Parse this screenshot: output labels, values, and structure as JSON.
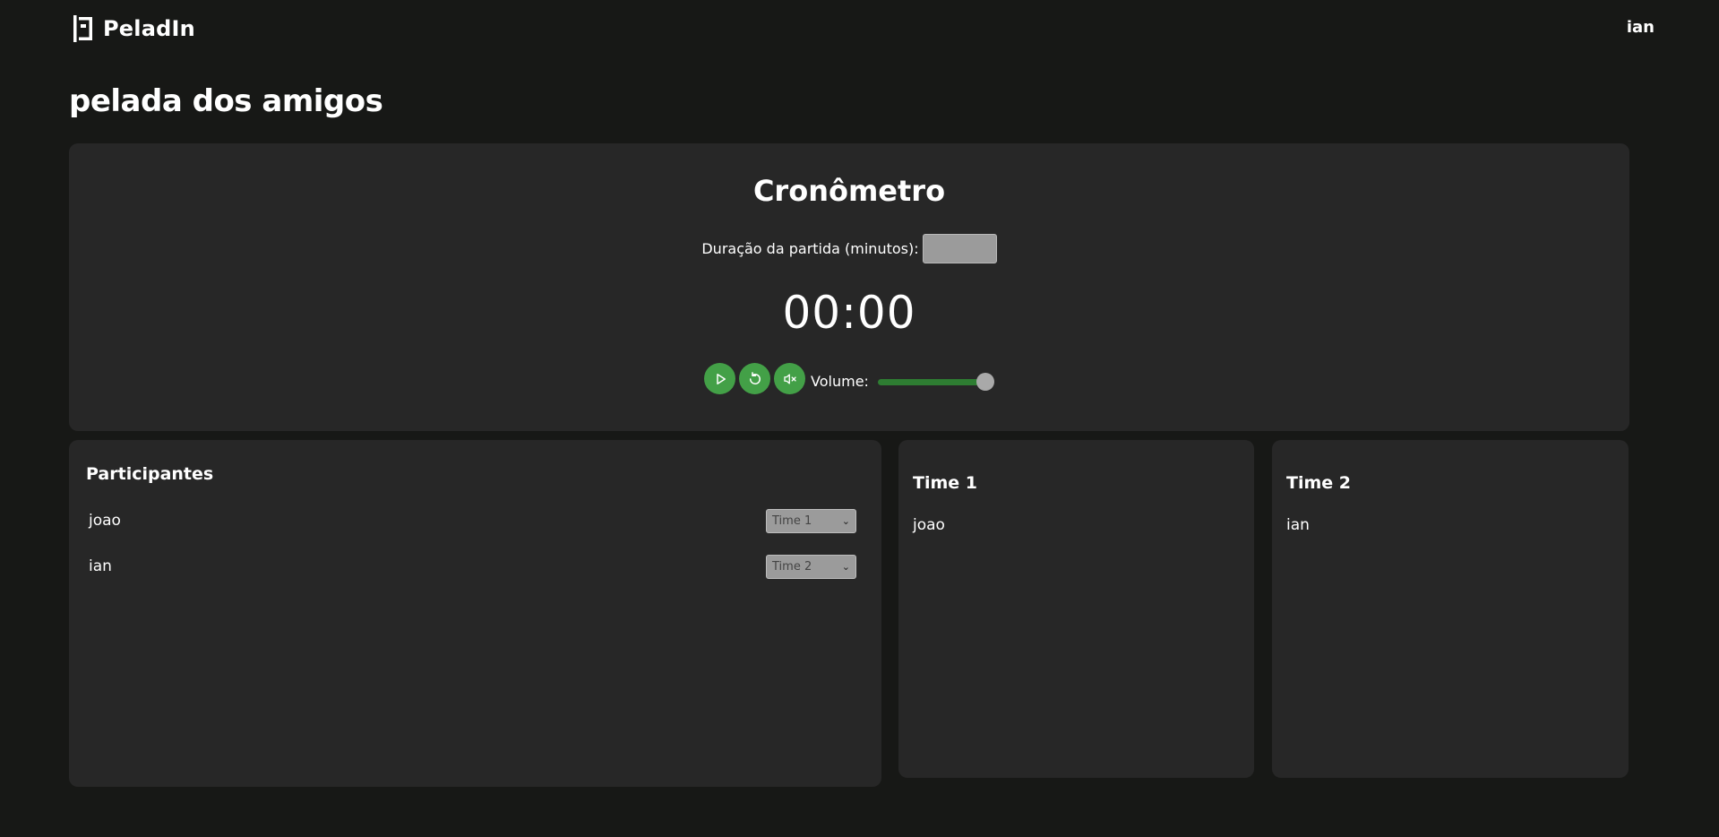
{
  "header": {
    "brand": "PeladIn",
    "user": "ian"
  },
  "page": {
    "title": "pelada dos amigos"
  },
  "timer": {
    "title": "Cronômetro",
    "duration_label": "Duração da partida (minutos):",
    "duration_value": "",
    "display": "00:00",
    "volume_label": "Volume:",
    "volume_level": 1.0
  },
  "participants": {
    "heading": "Participantes",
    "rows": [
      {
        "name": "joao",
        "team": "Time 1"
      },
      {
        "name": "ian",
        "team": "Time 2"
      }
    ]
  },
  "teams": [
    {
      "heading": "Time 1",
      "members": [
        "joao"
      ]
    },
    {
      "heading": "Time 2",
      "members": [
        "ian"
      ]
    }
  ],
  "colors": {
    "background": "#171816",
    "card": "#272727",
    "accent": "#43a047",
    "slider_fill": "#2e7d32"
  }
}
